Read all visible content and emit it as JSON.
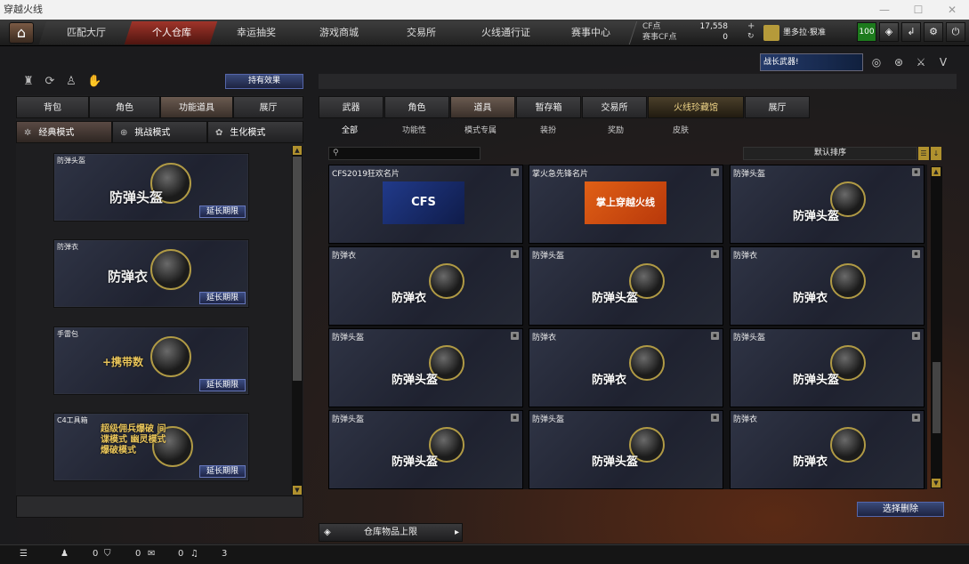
{
  "window": {
    "title": "穿越火线",
    "controls": [
      "—",
      "☐",
      "✕"
    ]
  },
  "nav": {
    "home_icon": "home-icon",
    "tabs": [
      "匹配大厅",
      "个人仓库",
      "幸运抽奖",
      "游戏商城",
      "交易所",
      "火线通行证",
      "赛事中心"
    ],
    "active_tab": "个人仓库"
  },
  "currency": {
    "cf_label": "CF点",
    "cf_value": "17,558",
    "match_label": "赛事CF点",
    "match_value": "0"
  },
  "user": {
    "name": "墨多拉·狠准",
    "level": "100"
  },
  "toolbar_icons": [
    "shield-icon",
    "exit-icon",
    "gear-icon",
    "power-icon"
  ],
  "left": {
    "effects_button": "持有效果",
    "tabs": [
      "背包",
      "角色",
      "功能道具",
      "展厅"
    ],
    "active_tab": "功能道具",
    "modes": [
      "经典模式",
      "挑战模式",
      "生化模式"
    ],
    "active_mode": "经典模式",
    "items": [
      {
        "name": "防弹头盔",
        "caption": "防弹头盔",
        "action": "延长期限"
      },
      {
        "name": "防弹衣",
        "caption": "防弹衣",
        "action": "延长期限"
      },
      {
        "name": "手雷包",
        "caption": "+携带数",
        "action": "延长期限"
      },
      {
        "name": "C4工具箱",
        "caption": "超级佣兵爆破 间谍模式 幽灵模式 爆破模式",
        "action": "延长期限"
      }
    ]
  },
  "right": {
    "banner": "战长武器!",
    "tabs": [
      "武器",
      "角色",
      "道具",
      "暂存箱",
      "交易所",
      "火线珍藏馆",
      "展厅"
    ],
    "active_tab": "道具",
    "subtabs": [
      "全部",
      "功能性",
      "模式专属",
      "装扮",
      "奖励",
      "皮肤"
    ],
    "active_subtab": "全部",
    "search_placeholder": "",
    "sort_label": "默认排序",
    "cards": [
      {
        "name": "CFS2019狂欢名片",
        "caption": "CFS",
        "kind": "logo-cfs"
      },
      {
        "name": "掌火急先锋名片",
        "caption": "掌上穿越火线",
        "kind": "logo-zh"
      },
      {
        "name": "防弹头盔",
        "caption": "防弹头盔",
        "kind": "helmet"
      },
      {
        "name": "防弹衣",
        "caption": "防弹衣",
        "kind": "vest"
      },
      {
        "name": "防弹头盔",
        "caption": "防弹头盔",
        "kind": "helmet"
      },
      {
        "name": "防弹衣",
        "caption": "防弹衣",
        "kind": "vest"
      },
      {
        "name": "防弹头盔",
        "caption": "防弹头盔",
        "kind": "helmet"
      },
      {
        "name": "防弹衣",
        "caption": "防弹衣",
        "kind": "vest"
      },
      {
        "name": "防弹头盔",
        "caption": "防弹头盔",
        "kind": "helmet"
      },
      {
        "name": "防弹头盔",
        "caption": "防弹头盔",
        "kind": "helmet"
      },
      {
        "name": "防弹头盔",
        "caption": "防弹头盔",
        "kind": "helmet"
      },
      {
        "name": "防弹衣",
        "caption": "防弹衣",
        "kind": "vest"
      }
    ],
    "delete_button": "选择删除",
    "capacity_button": "仓库物品上限"
  },
  "status": {
    "friends": "0",
    "messages": "0",
    "volume": "0",
    "count": "3"
  }
}
